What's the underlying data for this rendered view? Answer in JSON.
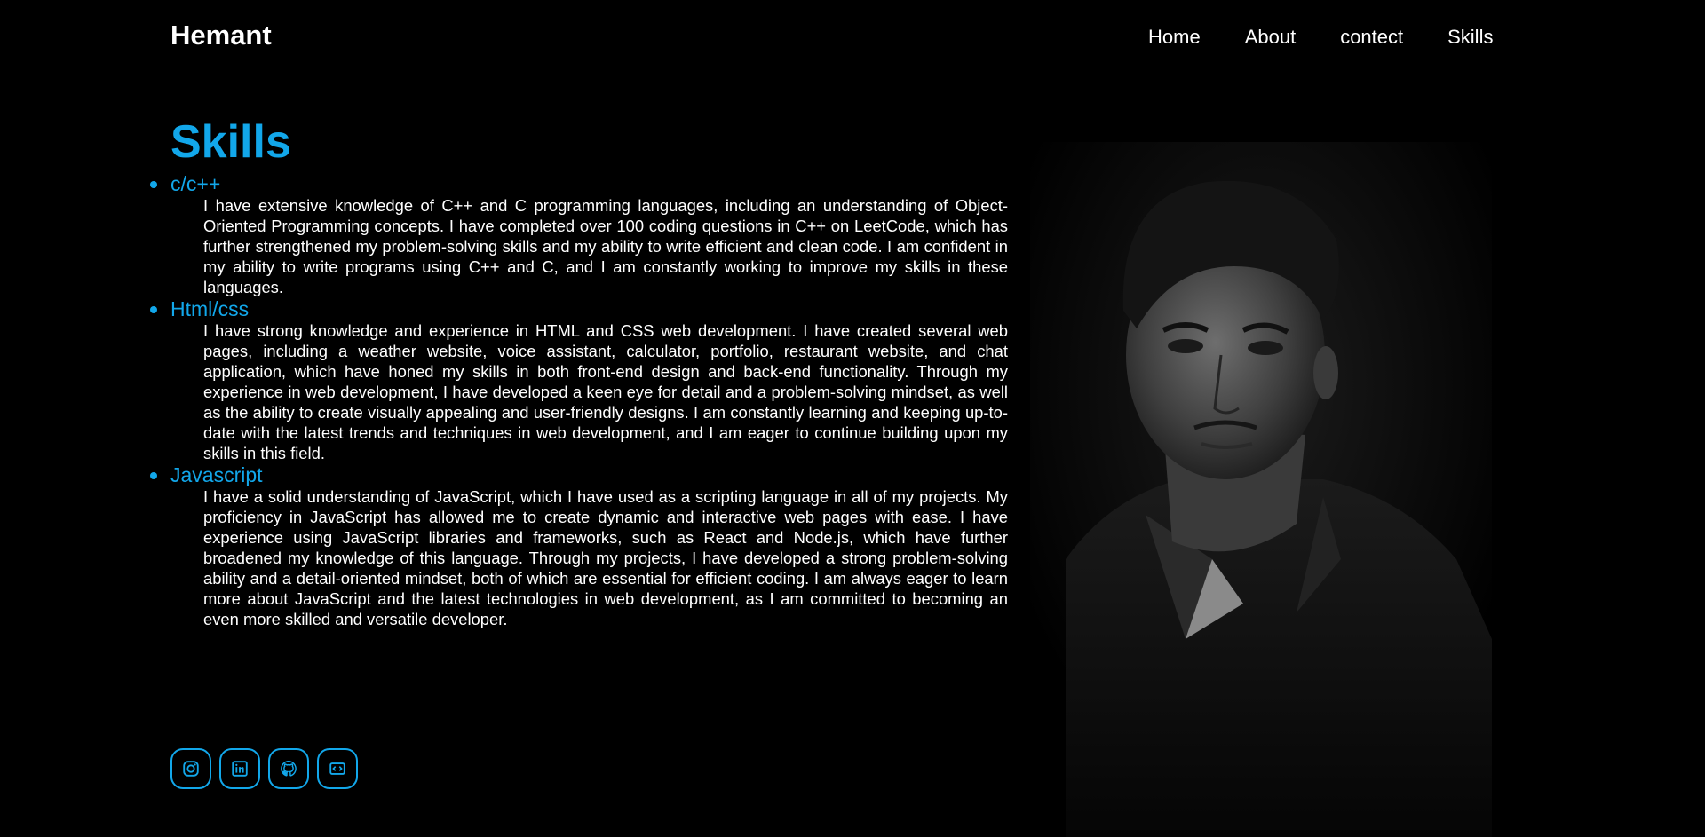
{
  "header": {
    "brand": "Hemant",
    "nav": [
      "Home",
      "About",
      "contect",
      "Skills"
    ]
  },
  "skills": {
    "title": "Skills",
    "items": [
      {
        "name": "c/c++",
        "description": "I have extensive knowledge of C++ and C programming languages, including an understanding of Object-Oriented Programming concepts. I have completed over 100 coding questions in C++ on LeetCode, which has further strengthened my problem-solving skills and my ability to write efficient and clean code. I am confident in my ability to write programs using C++ and C, and I am constantly working to improve my skills in these languages."
      },
      {
        "name": "Html/css",
        "description": "I have strong knowledge and experience in HTML and CSS web development. I have created several web pages, including a weather website, voice assistant, calculator, portfolio, restaurant website, and chat application, which have honed my skills in both front-end design and back-end functionality. Through my experience in web development, I have developed a keen eye for detail and a problem-solving mindset, as well as the ability to create visually appealing and user-friendly designs. I am constantly learning and keeping up-to-date with the latest trends and techniques in web development, and I am eager to continue building upon my skills in this field."
      },
      {
        "name": "Javascript",
        "description": "I have a solid understanding of JavaScript, which I have used as a scripting language in all of my projects. My proficiency in JavaScript has allowed me to create dynamic and interactive web pages with ease. I have experience using JavaScript libraries and frameworks, such as React and Node.js, which have further broadened my knowledge of this language. Through my projects, I have developed a strong problem-solving ability and a detail-oriented mindset, both of which are essential for efficient coding. I am always eager to learn more about JavaScript and the latest technologies in web development, as I am committed to becoming an even more skilled and versatile developer."
      }
    ]
  },
  "social": [
    {
      "icon": "instagram-icon"
    },
    {
      "icon": "linkedin-icon"
    },
    {
      "icon": "github-icon"
    },
    {
      "icon": "code-icon"
    }
  ],
  "colors": {
    "accent": "#12a7ea",
    "background": "#000000",
    "text": "#ffffff"
  }
}
